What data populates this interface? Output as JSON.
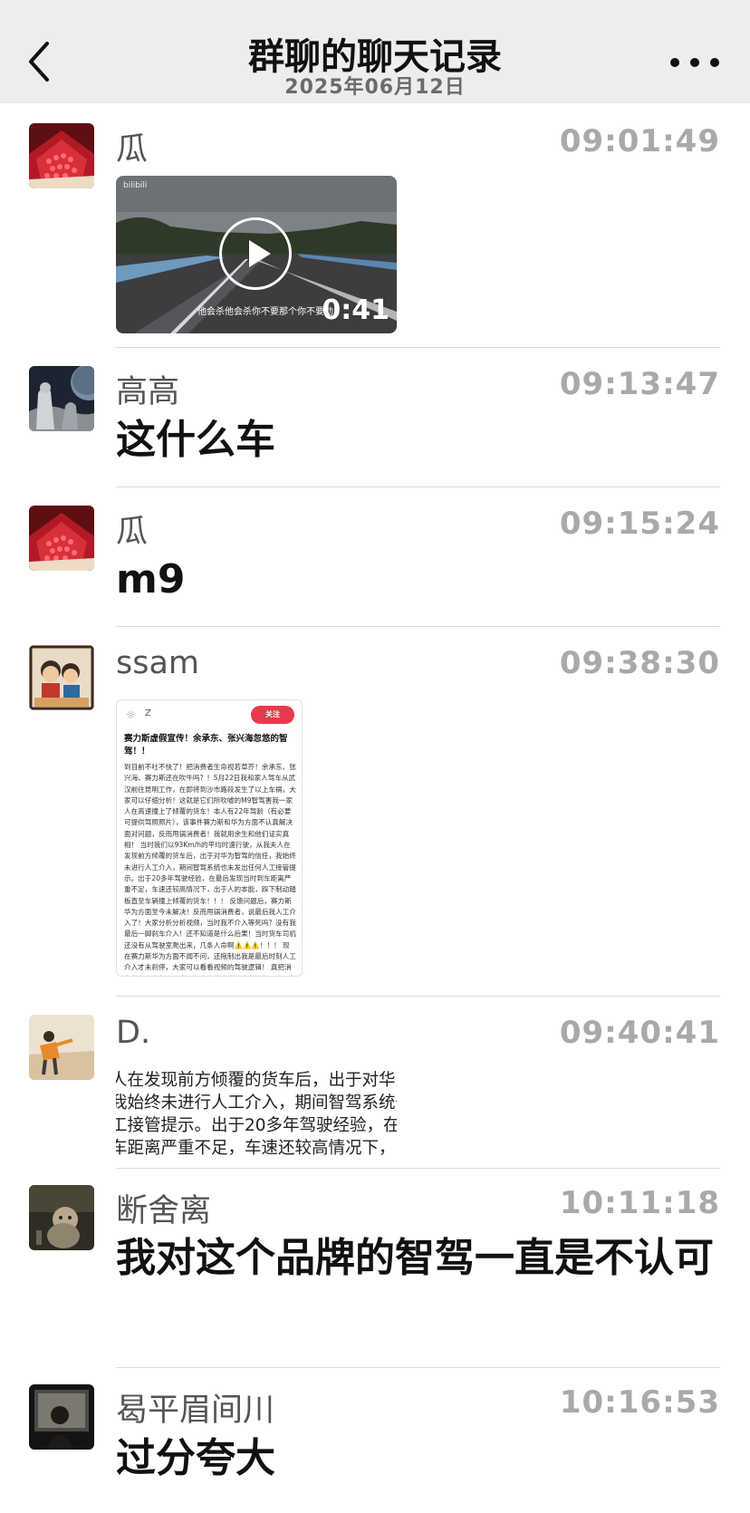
{
  "header": {
    "title": "群聊的聊天记录",
    "date": "2025年06月12日"
  },
  "messages": [
    {
      "name": "瓜",
      "time": "09:01:49",
      "type": "video",
      "video": {
        "duration": "0:41",
        "caption": "他会杀他会杀你不要那个你不要动",
        "watermark": "bilibili"
      }
    },
    {
      "name": "高高",
      "time": "09:13:47",
      "type": "text",
      "text": "这什么车"
    },
    {
      "name": "瓜",
      "time": "09:15:24",
      "type": "text",
      "text": "m9"
    },
    {
      "name": "ssam",
      "time": "09:38:30",
      "type": "document",
      "doc": {
        "author": "Z",
        "follow": "关注",
        "title": "赛力斯虚假宣传！余承东、张兴海忽悠的智驾！！",
        "body": "到目前不吐不快了！把消费者生命视若草芥！余承东、张兴海、赛力斯还在吹牛吗？！5月22日我和家人驾车从武汉前往昆明工作，在即将到沙市路段发生了以上车祸，大家可以仔细分析！这就是它们所吹嘘的M9智驾害我一家人在高速撞上了倾覆的货车！本人有22年驾龄（有必要可提供驾照照片），该事件赛力斯和华为方面不认真解决面对问题，反而甩锅消费者！我就用余生和他们证实真相！ 当时我们以93Km/h的平均时速行驶，从我夫人在发现前方倾覆的货车后，出于对华为智驾的信任，我始终未进行人工介入，期间智驾系统也未发出任何人工接管提示。出于20多年驾驶经验，在最后发现当时到车距离严重不足，车速还较高情况下，出于人的本能，踩下制动踏板直至车辆撞上倾覆的货车！！！ 反馈问题后，赛力斯华为方面至今未解决！反而甩锅消费者，说最后我人工介入了！大家分析分析视频，当时我不介入等死吗？没有我最后一脚刹车介入！还不知道是什么后果！当时货车司机还没有从驾驶室爬出来，几条人命啊⚠️⚠️⚠️！！！ 现在赛力斯华为方面不闻不问，还拖制出我是最后时刻人工介入才未刹停，大家可以看看视频的驾驶逻辑！ 真把消费者当小白鼠了？发现频出来让广大消费者评判！余承东在发布会上说过的车"
      }
    },
    {
      "name": "D.",
      "time": "09:40:41",
      "type": "snippet",
      "snippet": [
        "人在发现前方倾覆的货车后，出于对华为智",
        "我始终未进行人工介入，期间智驾系统也未",
        "工接管提示。出于20多年驾驶经验，在最后",
        "车距离严重不足，车速还较高情况下，出于"
      ]
    },
    {
      "name": "断舍离",
      "time": "10:11:18",
      "type": "text",
      "text": "我对这个品牌的智驾一直是不认可"
    },
    {
      "name": "曷平眉间川",
      "time": "10:16:53",
      "type": "text",
      "text": "过分夸大"
    }
  ],
  "colors": {
    "nav_bg": "#ededed",
    "timestamp": "#a9a9a9",
    "name": "#555555",
    "follow_btn": "#e83a4c"
  },
  "icons": [
    "back-chevron-icon",
    "more-dots-icon",
    "play-icon"
  ]
}
